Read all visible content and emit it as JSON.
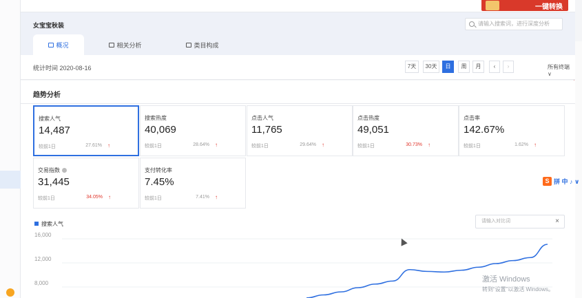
{
  "promo": {
    "label": "一键转换"
  },
  "header": {
    "shop_name": "女宝宝秋装",
    "search_placeholder": "请输入搜索词，进行深度分析"
  },
  "tabs": [
    {
      "label": "概况",
      "active": true
    },
    {
      "label": "相关分析",
      "active": false
    },
    {
      "label": "类目构成",
      "active": false
    }
  ],
  "stat": {
    "date_label": "统计时间 2020-08-16",
    "range_buttons": [
      {
        "label": "7天",
        "active": false
      },
      {
        "label": "30天",
        "active": false
      },
      {
        "label": "日",
        "active": true
      },
      {
        "label": "周",
        "active": false
      },
      {
        "label": "月",
        "active": false
      },
      {
        "label": "‹",
        "active": false
      },
      {
        "label": "›",
        "active": false
      }
    ],
    "terminal": "所有终端 ∨"
  },
  "trend": {
    "title": "趋势分析"
  },
  "metrics": [
    {
      "label": "搜索人气",
      "value": "14,487",
      "compare": "较前1日",
      "change": "27.61%",
      "change_red": false,
      "selected": true,
      "info": false
    },
    {
      "label": "搜索热度",
      "value": "40,069",
      "compare": "较前1日",
      "change": "28.64%",
      "change_red": false,
      "selected": false,
      "info": false
    },
    {
      "label": "点击人气",
      "value": "11,765",
      "compare": "较前1日",
      "change": "29.64%",
      "change_red": false,
      "selected": false,
      "info": false
    },
    {
      "label": "点击热度",
      "value": "49,051",
      "compare": "较前1日",
      "change": "30.73%",
      "change_red": true,
      "selected": false,
      "info": false
    },
    {
      "label": "点击率",
      "value": "142.67%",
      "compare": "较前1日",
      "change": "1.62%",
      "change_red": false,
      "selected": false,
      "info": false
    },
    {
      "label": "交易指数",
      "value": "31,445",
      "compare": "较前1日",
      "change": "34.05%",
      "change_red": true,
      "selected": false,
      "info": true
    },
    {
      "label": "支付转化率",
      "value": "7.45%",
      "compare": "较前1日",
      "change": "7.41%",
      "change_red": false,
      "selected": false,
      "info": false
    }
  ],
  "chart_legend": "搜索人气",
  "compare_placeholder": "请输入对比词",
  "watermark": {
    "line1": "激活 Windows",
    "line2": "转到“设置”以激活 Windows。"
  },
  "ime": {
    "s": "S",
    "text": "拼 中 ♪ ∨"
  },
  "colors": {
    "accent": "#2e6fe0",
    "up": "#e0342a",
    "promo": "#d9392a"
  },
  "chart_data": {
    "type": "line",
    "ylim": [
      6000,
      17000
    ],
    "ytick_labels": [
      "16,000",
      "12,000",
      "8,000"
    ],
    "yticks": [
      16000,
      12000,
      8000
    ],
    "series": [
      {
        "name": "搜索人气",
        "values": [
          5500,
          6000,
          6500,
          7200,
          7800,
          8300,
          10200,
          9900,
          9800,
          10100,
          10600,
          11200,
          11700,
          12200,
          14400
        ]
      }
    ],
    "x": [
      0,
      1,
      2,
      3,
      4,
      5,
      6,
      7,
      8,
      9,
      10,
      11,
      12,
      13,
      14
    ]
  }
}
